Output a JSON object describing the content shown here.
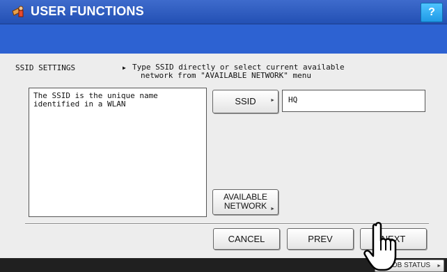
{
  "header": {
    "title": "USER FUNCTIONS",
    "help_label": "?",
    "icon": "user-functions-icon"
  },
  "panel": {
    "section_label": "SSID SETTINGS",
    "instruction_line1": "Type SSID directly or select current available",
    "instruction_line2": "network from \"AVAILABLE NETWORK\" menu",
    "info_line1": "The SSID is the unique name",
    "info_line2": "identified in a WLAN"
  },
  "ssid": {
    "button_label": "SSID",
    "value": "HQ"
  },
  "available_network": {
    "line1": "AVAILABLE",
    "line2": "NETWORK"
  },
  "navigation": {
    "cancel_label": "CANCEL",
    "prev_label": "PREV",
    "next_label": "NEXT"
  },
  "footer": {
    "job_status_label": "JOB STATUS"
  },
  "colors": {
    "header_blue": "#2350b4",
    "band_blue": "#2d62d2",
    "help_cyan": "#1f9ae6",
    "panel_gray": "#ededed"
  }
}
